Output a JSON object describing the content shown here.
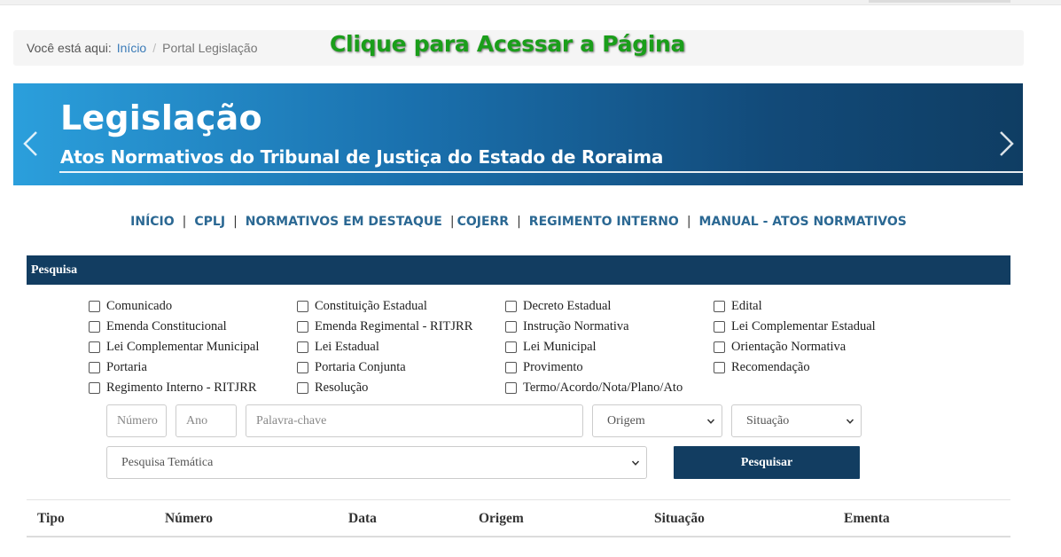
{
  "breadcrumb": {
    "prefix": "Você está aqui:",
    "home": "Início",
    "separator": "/",
    "current": "Portal Legislação"
  },
  "overlay": {
    "text": "Clique para Acessar a Página",
    "color": "#1a9e1a"
  },
  "banner": {
    "title": "Legislação",
    "subtitle": "Atos Normativos do Tribunal de Justiça do Estado de Roraima",
    "prev_icon": "chevron-left-icon",
    "next_icon": "chevron-right-icon"
  },
  "nav": {
    "separator": "|",
    "links": [
      "INÍCIO",
      "CPLJ",
      "NORMATIVOS EM DESTAQUE",
      "COJERR",
      "REGIMENTO INTERNO",
      "MANUAL - ATOS NORMATIVOS"
    ]
  },
  "search": {
    "header": "Pesquisa",
    "types": [
      "Comunicado",
      "Constituição Estadual",
      "Decreto Estadual",
      "Edital",
      "Emenda Constitucional",
      "Emenda Regimental - RITJRR",
      "Instrução Normativa",
      "Lei Complementar Estadual",
      "Lei Complementar Municipal",
      "Lei Estadual",
      "Lei Municipal",
      "Orientação Normativa",
      "Portaria",
      "Portaria Conjunta",
      "Provimento",
      "Recomendação",
      "Regimento Interno - RITJRR",
      "Resolução",
      "Termo/Acordo/Nota/Plano/Ato"
    ],
    "numero_placeholder": "Número",
    "ano_placeholder": "Ano",
    "palavra_placeholder": "Palavra-chave",
    "origem_selected": "Origem",
    "situacao_selected": "Situação",
    "tematica_selected": "Pesquisa Temática",
    "button_label": "Pesquisar"
  },
  "table": {
    "headers": [
      "Tipo",
      "Número",
      "Data",
      "Origem",
      "Situação",
      "Ementa"
    ]
  },
  "colors": {
    "primary_dark": "#123d61",
    "link_blue": "#2b6893",
    "banner_light": "#2b9fdc"
  }
}
